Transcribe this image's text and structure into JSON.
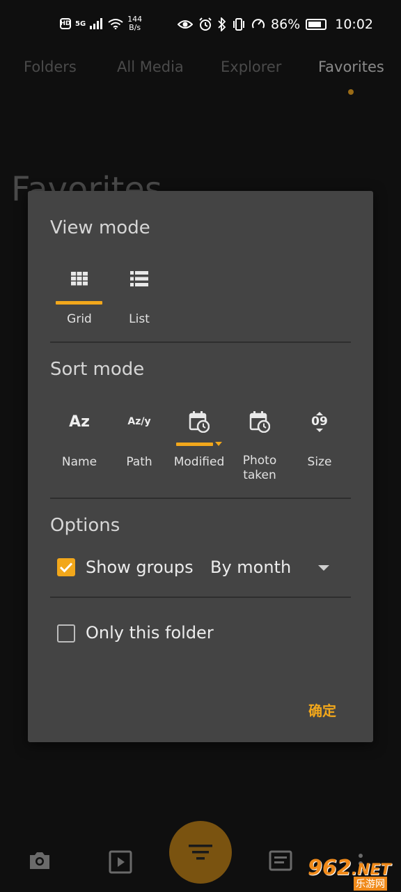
{
  "status_bar": {
    "hd": "HD",
    "network": "5G",
    "speed_value": "144",
    "speed_unit": "B/s",
    "battery": "86%",
    "time": "10:02"
  },
  "tabs": [
    {
      "label": "Folders"
    },
    {
      "label": "All Media"
    },
    {
      "label": "Explorer"
    },
    {
      "label": "Favorites",
      "active": true
    }
  ],
  "page_title": "Favorites",
  "dialog": {
    "view_mode": {
      "title": "View mode",
      "options": [
        {
          "label": "Grid",
          "icon": "grid-icon",
          "selected": true
        },
        {
          "label": "List",
          "icon": "list-icon",
          "selected": false
        }
      ]
    },
    "sort_mode": {
      "title": "Sort mode",
      "options": [
        {
          "label": "Name",
          "glyph": "Az",
          "icon": "name-sort-icon"
        },
        {
          "label": "Path",
          "glyph": "Az/y",
          "icon": "path-sort-icon"
        },
        {
          "label": "Modified",
          "icon": "calendar-clock-icon",
          "selected": true
        },
        {
          "label": "Photo\ntaken",
          "icon": "calendar-clock-icon"
        },
        {
          "label": "Size",
          "glyph": "09",
          "icon": "size-sort-icon"
        }
      ]
    },
    "options": {
      "title": "Options",
      "show_groups": {
        "label": "Show groups",
        "checked": true
      },
      "group_by": {
        "value": "By month"
      },
      "only_this_folder": {
        "label": "Only this folder",
        "checked": false
      }
    },
    "confirm_label": "确定"
  },
  "watermark": {
    "number": "962",
    "suffix": ".NET",
    "site": "乐游网"
  },
  "colors": {
    "accent": "#f2a71b",
    "dialog_bg": "#444444",
    "background": "#0f0f0f"
  }
}
